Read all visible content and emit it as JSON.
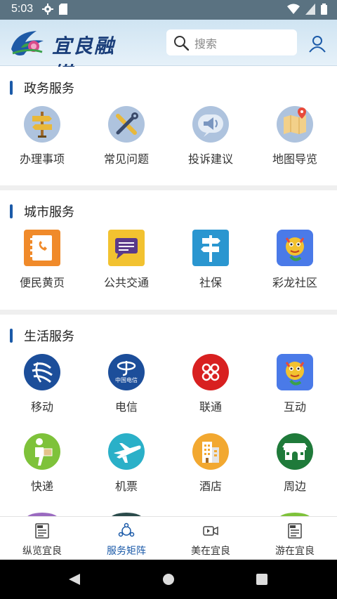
{
  "status_bar": {
    "time": "5:03"
  },
  "header": {
    "logo_text": "宜良融媒",
    "search_placeholder": "搜索"
  },
  "sections": [
    {
      "title": "政务服务",
      "items": [
        {
          "label": "办理事项",
          "icon": "signpost-icon"
        },
        {
          "label": "常见问题",
          "icon": "tools-icon"
        },
        {
          "label": "投诉建议",
          "icon": "megaphone-icon"
        },
        {
          "label": "地图导览",
          "icon": "map-icon"
        }
      ]
    },
    {
      "title": "城市服务",
      "items": [
        {
          "label": "便民黄页",
          "icon": "phonebook-icon"
        },
        {
          "label": "公共交通",
          "icon": "chat-bubble-icon"
        },
        {
          "label": "社保",
          "icon": "direction-sign-icon"
        },
        {
          "label": "彩龙社区",
          "icon": "dragon-icon"
        }
      ]
    },
    {
      "title": "生活服务",
      "items": [
        {
          "label": "移动",
          "icon": "china-mobile-icon"
        },
        {
          "label": "电信",
          "icon": "china-telecom-icon"
        },
        {
          "label": "联通",
          "icon": "china-unicom-icon"
        },
        {
          "label": "互动",
          "icon": "dragon-icon"
        },
        {
          "label": "快递",
          "icon": "courier-icon"
        },
        {
          "label": "机票",
          "icon": "airplane-icon"
        },
        {
          "label": "酒店",
          "icon": "hotel-icon"
        },
        {
          "label": "周边",
          "icon": "gate-icon"
        }
      ]
    }
  ],
  "telecom_logo_text": "中国电信",
  "bottom_nav": [
    {
      "label": "纵览宜良",
      "icon": "news-icon",
      "active": false
    },
    {
      "label": "服务矩阵",
      "icon": "network-icon",
      "active": true
    },
    {
      "label": "美在宜良",
      "icon": "video-icon",
      "active": false
    },
    {
      "label": "游在宜良",
      "icon": "news-icon",
      "active": false
    }
  ],
  "colors": {
    "accent": "#1b5aa8",
    "status_bar": "#5a7281",
    "divider": "#efefef"
  }
}
